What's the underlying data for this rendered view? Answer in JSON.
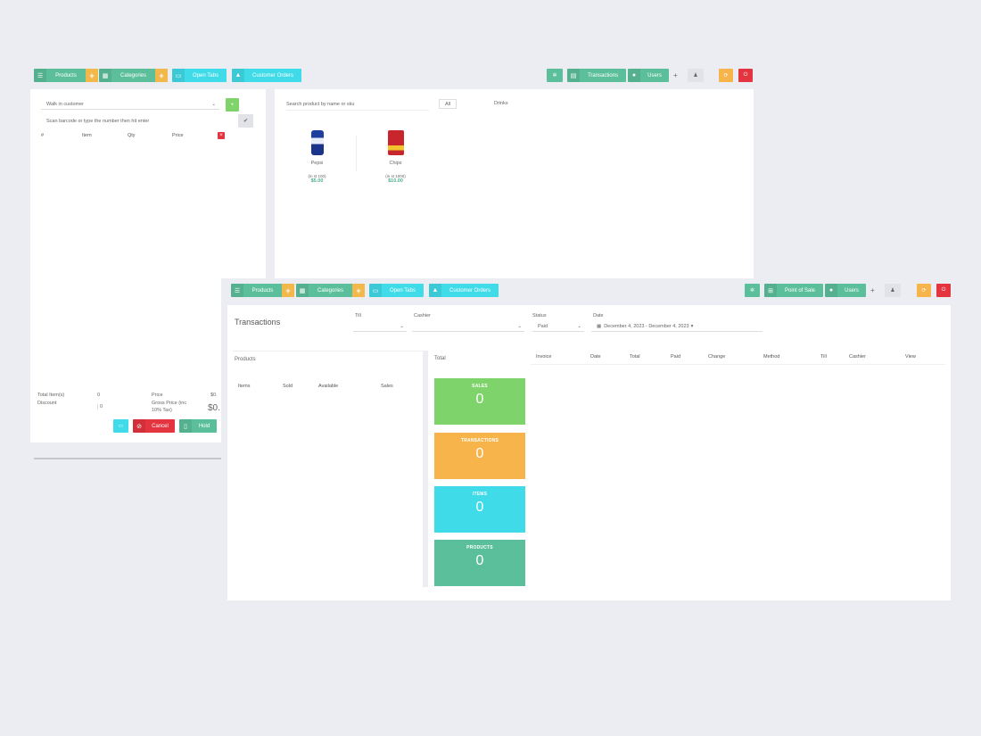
{
  "back": {
    "nav": {
      "products": "Products",
      "categories": "Categories",
      "open_tabs": "Open Tabs",
      "customer_orders": "Customer Orders",
      "transactions": "Transactions",
      "users": "Users"
    },
    "cart": {
      "customer_placeholder": "Walk in customer",
      "barcode_placeholder": "Scan barcode or type the number then hit enter",
      "columns": [
        "#",
        "Item",
        "Qty",
        "Price"
      ],
      "totals": {
        "total_items_label": "Total Item(s)",
        "total_items_value": "0",
        "discount_label": "Discount",
        "discount_value": "0",
        "price_label": "Price",
        "price_value": "$0.",
        "gross_label": "Gross Price (inc",
        "tax_label": "10% Tax)",
        "gross_value": "$0."
      },
      "cancel": "Cancel",
      "hold": "Hold"
    },
    "products": {
      "search_placeholder": "Search product by name or sku",
      "filter_all": "All",
      "filter_drinks": "Drinks",
      "items": [
        {
          "name": "Pepsi",
          "stock": "(in st 100)",
          "price": "$5.00"
        },
        {
          "name": "Chips",
          "stock": "(in st 1000)",
          "price": "$10.00"
        }
      ]
    }
  },
  "front": {
    "nav": {
      "products": "Products",
      "categories": "Categories",
      "open_tabs": "Open Tabs",
      "customer_orders": "Customer Orders",
      "point_of_sale": "Point of Sale",
      "users": "Users"
    },
    "title": "Transactions",
    "filters": {
      "till_label": "Till",
      "cashier_label": "Cashier",
      "status_label": "Status",
      "status_value": "Paid",
      "date_label": "Date",
      "date_value": "December 4, 2023 - December 4, 2023"
    },
    "products_panel": {
      "title": "Products",
      "columns": [
        "Items",
        "Sold",
        "Available",
        "Sales"
      ]
    },
    "total_label": "Total",
    "cards": [
      {
        "title": "SALES",
        "value": "0",
        "color": "#7fd36b"
      },
      {
        "title": "TRANSACTIONS",
        "value": "0",
        "color": "#f6b44b"
      },
      {
        "title": "ITEMS",
        "value": "0",
        "color": "#3fdbe8"
      },
      {
        "title": "PRODUCTS",
        "value": "0",
        "color": "#5cbf9c"
      }
    ],
    "table_columns": [
      "Invoice",
      "Date",
      "Total",
      "Paid",
      "Change",
      "Method",
      "Till",
      "Cashier",
      "View"
    ]
  }
}
